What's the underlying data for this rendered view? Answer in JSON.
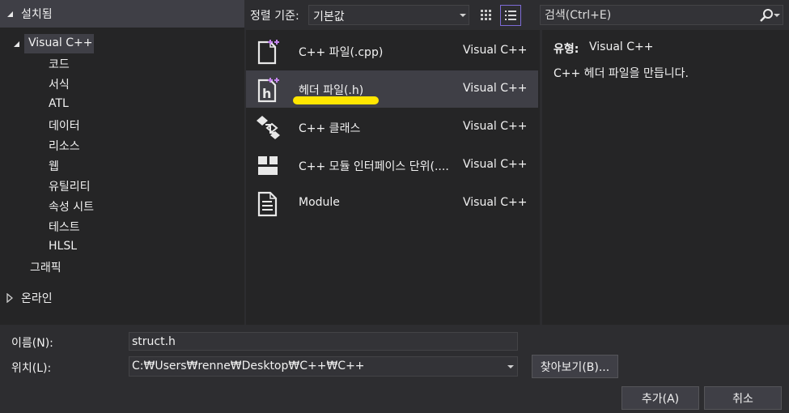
{
  "tree": {
    "installed": "설치됨",
    "visual_cpp": "Visual C++",
    "children": [
      "코드",
      "서식",
      "ATL",
      "데이터",
      "리소스",
      "웹",
      "유틸리티",
      "속성 시트",
      "테스트",
      "HLSL"
    ],
    "graphics": "그래픽",
    "online": "온라인"
  },
  "toolbar": {
    "sort_label": "정렬 기준:",
    "sort_value": "기본값",
    "search_placeholder": "검색(Ctrl+E)"
  },
  "templates": [
    {
      "name": "C++ 파일(.cpp)",
      "lang": "Visual C++",
      "icon": "cpp-file-icon"
    },
    {
      "name": "헤더 파일(.h)",
      "lang": "Visual C++",
      "icon": "header-file-icon"
    },
    {
      "name": "C++ 클래스",
      "lang": "Visual C++",
      "icon": "class-icon"
    },
    {
      "name": "C++ 모듈 인터페이스 단위(....",
      "lang": "Visual C++",
      "icon": "module-interface-icon"
    },
    {
      "name": "Module",
      "lang": "Visual C++",
      "icon": "module-file-icon"
    }
  ],
  "selected_index": 1,
  "description": {
    "type_label": "유형:",
    "type_value": "Visual C++",
    "text": "C++ 헤더 파일을 만듭니다."
  },
  "form": {
    "name_label": "이름(N):",
    "name_value": "struct.h",
    "location_label": "위치(L):",
    "location_value": "C:₩Users₩renne₩Desktop₩C++₩C++",
    "browse_label": "찾아보기(B)...",
    "add_label": "추가(A)",
    "cancel_label": "취소"
  },
  "colors": {
    "background": "#2d2d30",
    "panel": "#252526",
    "selected": "#3f3f46",
    "accent": "#7d6bd6",
    "highlighter": "#ffe600"
  }
}
